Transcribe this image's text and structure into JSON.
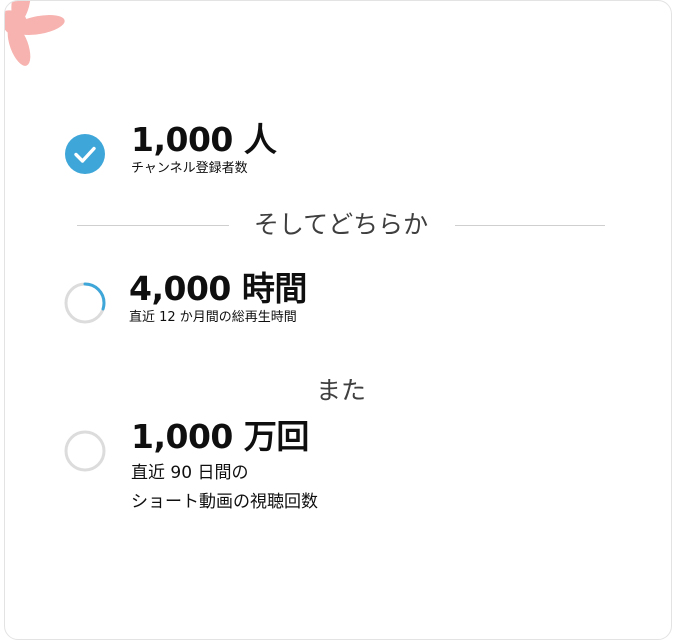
{
  "requirements": [
    {
      "value": "1,000 人",
      "sub": [
        "チャンネル登録者数"
      ],
      "status": "complete",
      "progress": 1.0
    },
    {
      "value": "4,000 時間",
      "sub": [
        "直近 12 か月間の総再生時間"
      ],
      "status": "in-progress",
      "progress": 0.3
    },
    {
      "value": "1,000 万回",
      "sub": [
        "直近 90 日間の",
        "ショート動画の視聴回数"
      ],
      "status": "not-started",
      "progress": 0.0
    }
  ],
  "connectors": {
    "and_either": "そしてどちらか",
    "or": "また"
  },
  "colors": {
    "accent": "#3ea6d8",
    "ring_track": "#dcdcdc",
    "divider": "#cfcfcf",
    "decoration": "#f7b3b0"
  },
  "icons": {
    "complete": "check-circle-icon",
    "progress": "progress-ring-icon",
    "empty": "empty-circle-icon"
  }
}
